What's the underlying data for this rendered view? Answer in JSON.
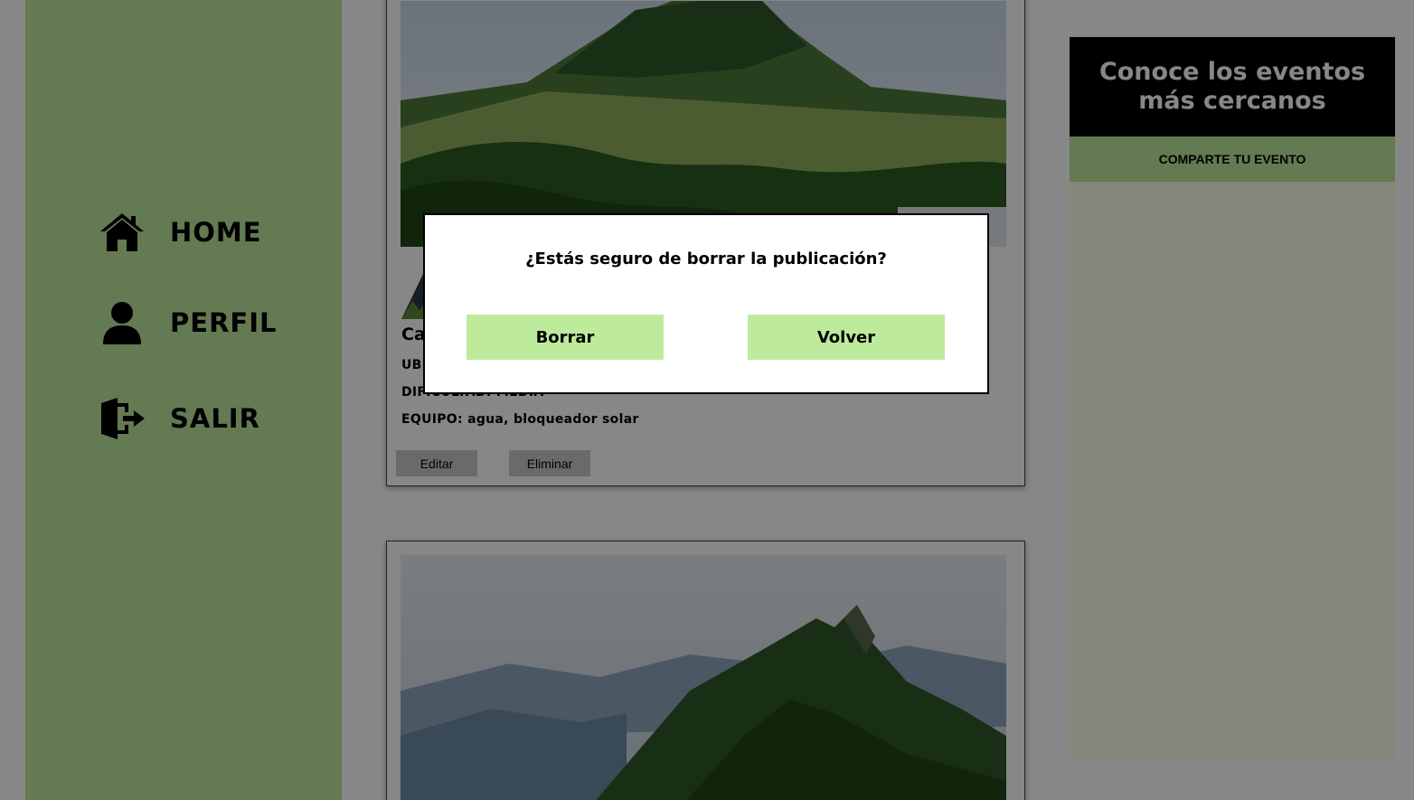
{
  "nav": {
    "items": [
      {
        "label": "HOME",
        "icon": "home-icon"
      },
      {
        "label": "PERFIL",
        "icon": "user-icon"
      },
      {
        "label": "SALIR",
        "icon": "logout-icon"
      }
    ]
  },
  "posts": [
    {
      "title": "Ca",
      "ubicacion_label": "UBI",
      "dificultad": "DIFICULTAD: MEDIA",
      "equipo": "EQUIPO: agua, bloqueador solar",
      "edit_label": "Editar",
      "delete_label": "Eliminar"
    }
  ],
  "events": {
    "heading": "Conoce los eventos más cercanos",
    "share_label": "COMPARTE TU EVENTO"
  },
  "modal": {
    "question": "¿Estás seguro de borrar la publicación?",
    "confirm_label": "Borrar",
    "back_label": "Volver"
  },
  "colors": {
    "sidebar": "#bde69c",
    "modal_button": "#bdeb9b",
    "events_header": "#000000",
    "events_panel": "#fbffe6"
  }
}
